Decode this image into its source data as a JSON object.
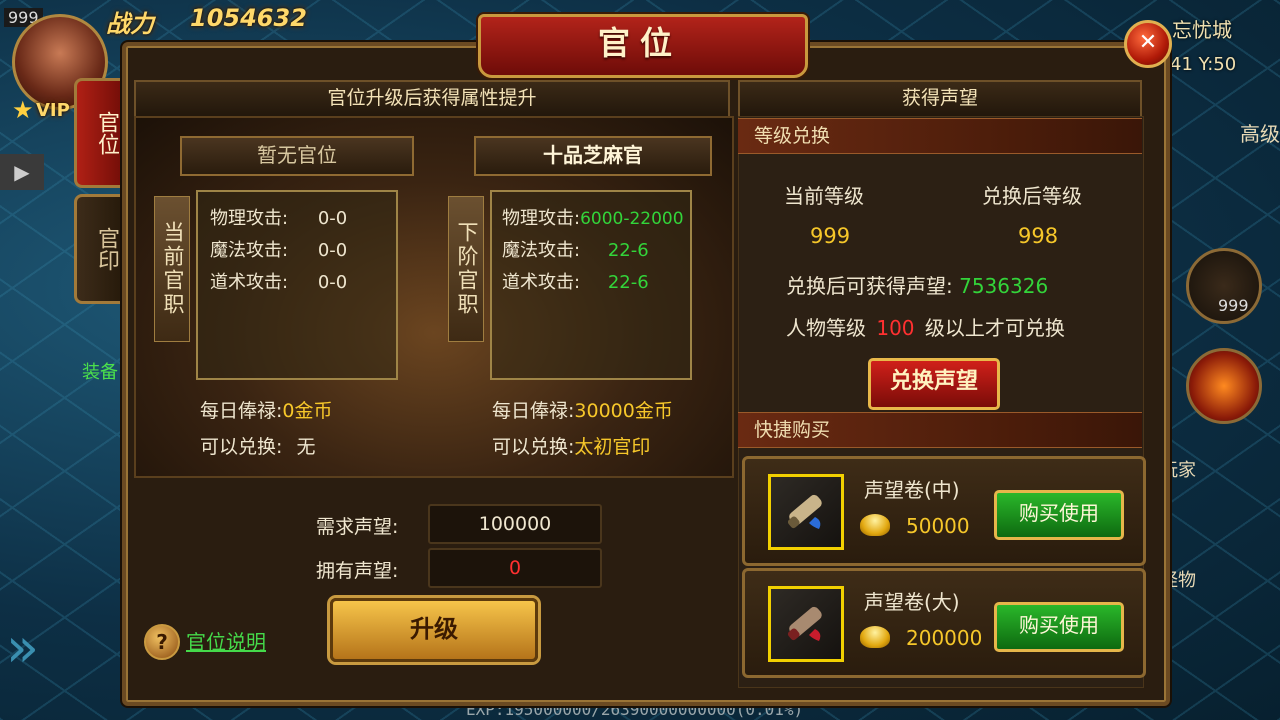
{
  "hud": {
    "level_badge": "999",
    "combat_power_label": "战力",
    "combat_power_value": "1054632",
    "vip_label": "VIP",
    "map_name": "忘忧城",
    "coords": "41 Y:50",
    "right_label_1": "高级",
    "right_label_2": "装备",
    "right_label_3": "玩家",
    "right_label_4": "怪物",
    "right_icon_badge": "999",
    "exp_text": "EXP:195000000/26390000000000(0.01%)"
  },
  "window": {
    "title": "官位",
    "close_icon": "close-icon"
  },
  "side_tabs": [
    {
      "label": "官位",
      "active": true
    },
    {
      "label": "官印",
      "active": false
    }
  ],
  "left_panel": {
    "header": "官位升级后获得属性提升",
    "current": {
      "rank_name": "暂无官位",
      "vertical_label": "当前官职",
      "stats": [
        {
          "label": "物理攻击:",
          "value": "0-0"
        },
        {
          "label": "魔法攻击:",
          "value": "0-0"
        },
        {
          "label": "道术攻击:",
          "value": "0-0"
        }
      ],
      "salary_label": "每日俸禄:",
      "salary_value": "0金币",
      "exchange_label": "可以兑换:",
      "exchange_value": "无"
    },
    "next": {
      "rank_name": "十品芝麻官",
      "vertical_label": "下阶官职",
      "stats": [
        {
          "label": "物理攻击:",
          "value": "6000-22000"
        },
        {
          "label": "魔法攻击:",
          "value": "22-6"
        },
        {
          "label": "道术攻击:",
          "value": "22-6"
        }
      ],
      "salary_label": "每日俸禄:",
      "salary_value": "30000金币",
      "exchange_label": "可以兑换:",
      "exchange_value": "太初官印"
    },
    "required_label": "需求声望:",
    "required_value": "100000",
    "owned_label": "拥有声望:",
    "owned_value": "0",
    "upgrade_button": "升级",
    "help_icon": "?",
    "help_link": "官位说明"
  },
  "right_panel": {
    "header": "获得声望",
    "level_exchange_title": "等级兑换",
    "current_level_label": "当前等级",
    "current_level_value": "999",
    "after_level_label": "兑换后等级",
    "after_level_value": "998",
    "gain_label": "兑换后可获得声望:",
    "gain_value": "7536326",
    "req_prefix": "人物等级",
    "req_level": "100",
    "req_suffix": "级以上才可兑换",
    "exchange_button": "兑换声望",
    "quick_buy_title": "快捷购买",
    "items": [
      {
        "name": "声望卷(中)",
        "price": "50000",
        "button": "购买使用",
        "ribbon_color": "#2b6cd8"
      },
      {
        "name": "声望卷(大)",
        "price": "200000",
        "button": "购买使用",
        "ribbon_color": "#c81c2c"
      }
    ]
  }
}
